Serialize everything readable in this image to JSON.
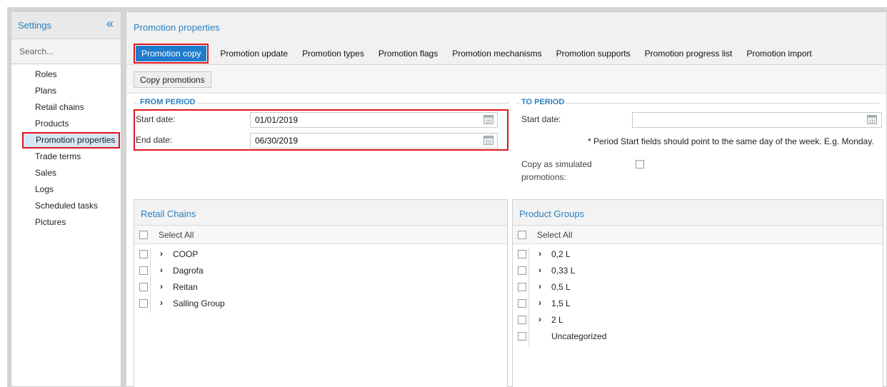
{
  "sidebar": {
    "title": "Settings",
    "collapse_icon": "double-chevron-left-icon",
    "search_placeholder": "Search...",
    "items": [
      {
        "label": "Roles"
      },
      {
        "label": "Plans"
      },
      {
        "label": "Retail chains"
      },
      {
        "label": "Products"
      },
      {
        "label": "Promotion properties",
        "active": true
      },
      {
        "label": "Trade terms"
      },
      {
        "label": "Sales"
      },
      {
        "label": "Logs"
      },
      {
        "label": "Scheduled tasks"
      },
      {
        "label": "Pictures"
      }
    ]
  },
  "main": {
    "title": "Promotion properties",
    "tabs": [
      {
        "label": "Promotion copy",
        "active": true
      },
      {
        "label": "Promotion update"
      },
      {
        "label": "Promotion types"
      },
      {
        "label": "Promotion flags"
      },
      {
        "label": "Promotion mechanisms"
      },
      {
        "label": "Promotion supports"
      },
      {
        "label": "Promotion progress list"
      },
      {
        "label": "Promotion import"
      }
    ],
    "toolbar": {
      "copy_button": "Copy promotions"
    },
    "from_period": {
      "legend": "FROM PERIOD",
      "start_label": "Start date:",
      "start_value": "01/01/2019",
      "end_label": "End date:",
      "end_value": "06/30/2019"
    },
    "to_period": {
      "legend": "TO PERIOD",
      "start_label": "Start date:",
      "start_value": "",
      "note": "* Period Start fields should point to the same day of the week. E.g. Monday.",
      "simulated_label": "Copy as simulated promotions:"
    },
    "retail_chains": {
      "title": "Retail Chains",
      "select_all": "Select All",
      "items": [
        "COOP",
        "Dagrofa",
        "Reitan",
        "Salling Group"
      ]
    },
    "product_groups": {
      "title": "Product Groups",
      "select_all": "Select All",
      "items": [
        "0,2 L",
        "0,33 L",
        "0,5 L",
        "1,5 L",
        "2 L"
      ],
      "uncategorized": "Uncategorized"
    }
  },
  "colors": {
    "accent": "#2a7fc0",
    "active_tab": "#1f7ccc",
    "highlight_outline": "#e0161e",
    "active_item_bg": "#d7e6f5"
  }
}
